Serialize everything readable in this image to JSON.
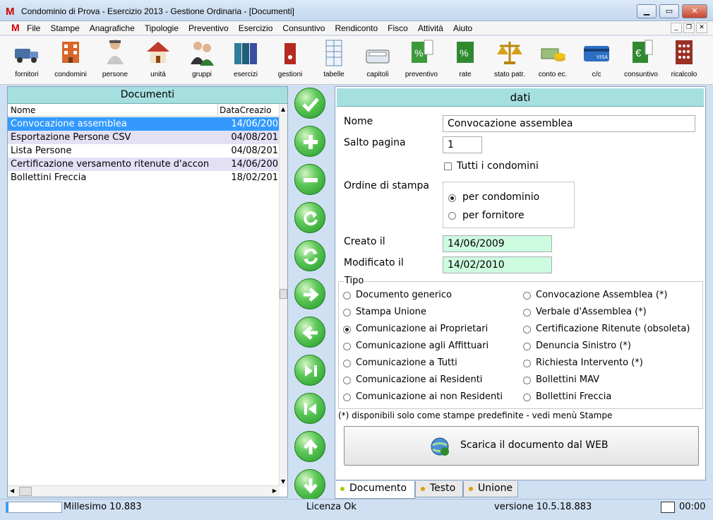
{
  "window": {
    "app_logo": "M",
    "title": "Condominio di Prova - Esercizio 2013 - Gestione Ordinaria - [Documenti]"
  },
  "menubar": {
    "logo": "M",
    "items": [
      "File",
      "Stampe",
      "Anagrafiche",
      "Tipologie",
      "Preventivo",
      "Esercizio",
      "Consuntivo",
      "Rendiconto",
      "Fisco",
      "Attività",
      "Aiuto"
    ]
  },
  "toolbar": {
    "items": [
      {
        "label": "fornitori",
        "icon": "truck-icon"
      },
      {
        "label": "condomini",
        "icon": "building-icon"
      },
      {
        "label": "persone",
        "icon": "person-icon"
      },
      {
        "label": "unità",
        "icon": "house-icon"
      },
      {
        "label": "gruppi",
        "icon": "group-icon"
      },
      {
        "label": "esercizi",
        "icon": "binders-icon"
      },
      {
        "label": "gestioni",
        "icon": "binder-icon"
      },
      {
        "label": "tabelle",
        "icon": "table-icon"
      },
      {
        "label": "capitoli",
        "icon": "calculator-icon"
      },
      {
        "label": "preventivo",
        "icon": "percent-doc-icon"
      },
      {
        "label": "rate",
        "icon": "percent-icon"
      },
      {
        "label": "stato patr.",
        "icon": "scales-icon"
      },
      {
        "label": "conto ec.",
        "icon": "money-icon"
      },
      {
        "label": "c/c",
        "icon": "card-icon"
      },
      {
        "label": "consuntivo",
        "icon": "euro-doc-icon"
      },
      {
        "label": "ricalcolo",
        "icon": "abacus-icon"
      }
    ]
  },
  "left_panel": {
    "title": "Documenti",
    "columns": [
      "Nome",
      "DataCreazio"
    ],
    "rows": [
      {
        "name": "Convocazione assemblea",
        "date": "14/06/200"
      },
      {
        "name": "Esportazione Persone CSV",
        "date": "04/08/201"
      },
      {
        "name": "Lista Persone",
        "date": "04/08/201"
      },
      {
        "name": "Certificazione versamento ritenute d'accon",
        "date": "14/06/200"
      },
      {
        "name": "Bollettini Freccia",
        "date": "18/02/201"
      }
    ],
    "selected_index": 0
  },
  "action_buttons": [
    {
      "name": "confirm",
      "icon": "check-icon"
    },
    {
      "name": "add",
      "icon": "plus-icon"
    },
    {
      "name": "remove",
      "icon": "minus-icon"
    },
    {
      "name": "undo",
      "icon": "undo-icon"
    },
    {
      "name": "refresh",
      "icon": "refresh-icon"
    },
    {
      "name": "next",
      "icon": "arrow-right-icon"
    },
    {
      "name": "previous",
      "icon": "arrow-left-icon"
    },
    {
      "name": "last",
      "icon": "skip-last-icon"
    },
    {
      "name": "first",
      "icon": "skip-first-icon"
    },
    {
      "name": "move-up",
      "icon": "arrow-up-icon"
    },
    {
      "name": "move-down",
      "icon": "arrow-down-icon"
    }
  ],
  "right_panel": {
    "title": "dati",
    "nome_label": "Nome",
    "nome_value": "Convocazione assemblea",
    "salto_label": "Salto pagina",
    "salto_value": "1",
    "tutti_label": "Tutti i condomini",
    "tutti_checked": false,
    "ordine_label": "Ordine di stampa",
    "ordine_options": [
      "per condominio",
      "per fornitore"
    ],
    "ordine_selected": 0,
    "creato_label": "Creato il",
    "creato_value": "14/06/2009",
    "modificato_label": "Modificato il",
    "modificato_value": "14/02/2010",
    "tipo_label": "Tipo",
    "tipo_left": [
      "Documento generico",
      "Stampa Unione",
      "Comunicazione ai Proprietari",
      "Comunicazione agli Affittuari",
      "Comunicazione a Tutti",
      "Comunicazione ai Residenti",
      "Comunicazione ai non Residenti"
    ],
    "tipo_right": [
      "Convocazione Assemblea (*)",
      "Verbale d'Assemblea (*)",
      "Certificazione Ritenute (obsoleta)",
      "Denuncia Sinistro (*)",
      "Richiesta Intervento (*)",
      "Bollettini MAV",
      "Bollettini Freccia"
    ],
    "tipo_selected": "Comunicazione ai Proprietari",
    "note": "(*) disponibili solo come stampe predefinite - vedi menù Stampe",
    "download_label": "Scarica il documento dal WEB"
  },
  "tabs": [
    "Documento",
    "Testo",
    "Unione"
  ],
  "active_tab": 0,
  "statusbar": {
    "millesimo": "Millesimo 10.883",
    "licenza": "Licenza Ok",
    "versione": "versione 10.5.18.883",
    "time": "00:00"
  }
}
